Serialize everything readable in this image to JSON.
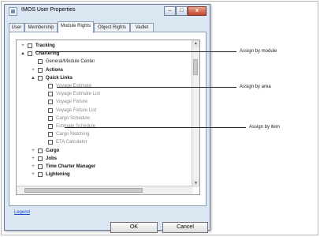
{
  "window": {
    "title": "IMOS User Properties"
  },
  "tabs": [
    "User",
    "Membership",
    "Module Rights",
    "Object Rights",
    "Vadlet"
  ],
  "tree": [
    {
      "label": "Tracking",
      "indent": 0,
      "bold": true,
      "expander": "+"
    },
    {
      "label": "Chartering",
      "indent": 0,
      "bold": true,
      "expander": "▲"
    },
    {
      "label": "General/Module Center",
      "indent": 1,
      "bold": false,
      "expander": ""
    },
    {
      "label": "Actions",
      "indent": 1,
      "bold": true,
      "expander": "+"
    },
    {
      "label": "Quick Links",
      "indent": 1,
      "bold": true,
      "expander": "▲"
    },
    {
      "label": "Voyage Estimate",
      "indent": 2,
      "dim": true,
      "expander": ""
    },
    {
      "label": "Voyage Estimate List",
      "indent": 2,
      "dim": true,
      "expander": ""
    },
    {
      "label": "Voyage Fixture",
      "indent": 2,
      "dim": true,
      "expander": ""
    },
    {
      "label": "Voyage Fixture List",
      "indent": 2,
      "dim": true,
      "expander": ""
    },
    {
      "label": "Cargo Schedule",
      "indent": 2,
      "dim": true,
      "expander": ""
    },
    {
      "label": "Estimate Schedule",
      "indent": 2,
      "dim": true,
      "expander": ""
    },
    {
      "label": "Cargo Matching",
      "indent": 2,
      "dim": true,
      "expander": ""
    },
    {
      "label": "ETA Calculator",
      "indent": 2,
      "dim": true,
      "expander": ""
    },
    {
      "label": "Cargo",
      "indent": 1,
      "bold": true,
      "expander": "+"
    },
    {
      "label": "Jobs",
      "indent": 1,
      "bold": true,
      "expander": "+"
    },
    {
      "label": "Time Charter Manager",
      "indent": 1,
      "bold": true,
      "expander": "+"
    },
    {
      "label": "Lightening",
      "indent": 1,
      "bold": true,
      "expander": "+"
    }
  ],
  "legend_link": "Legend",
  "buttons": {
    "ok": "OK",
    "cancel": "Cancel"
  },
  "annotations": [
    "Assign by module",
    "Assign by area",
    "Assign by item"
  ],
  "caption_controls": {
    "minimize": "–",
    "maximize": "□",
    "close": "x"
  }
}
